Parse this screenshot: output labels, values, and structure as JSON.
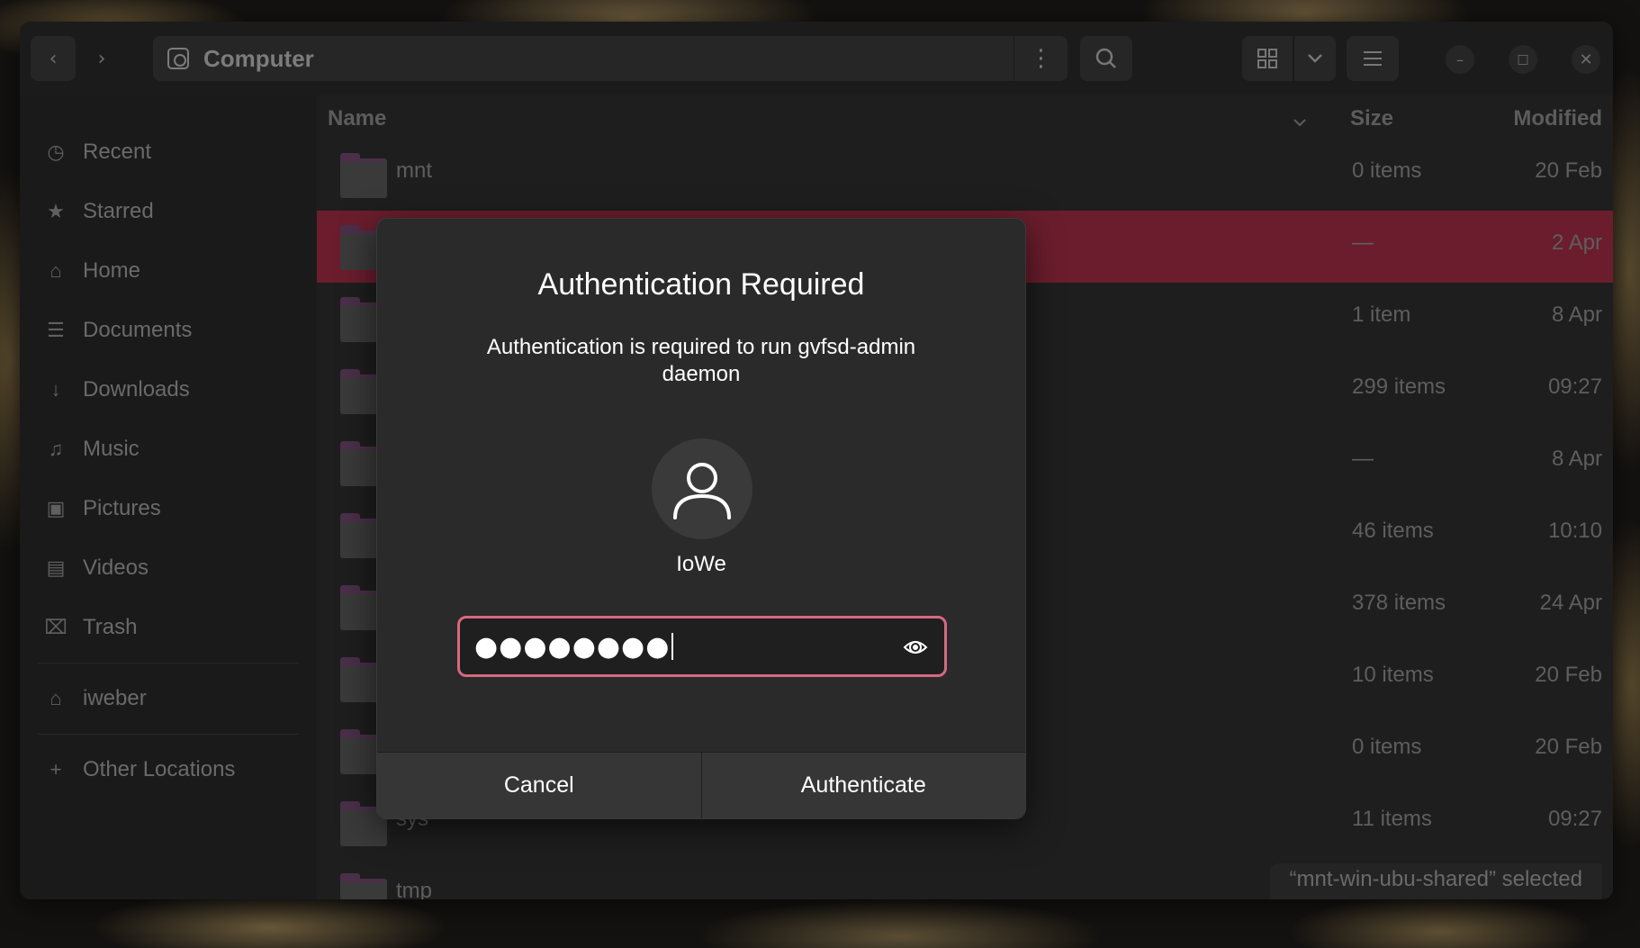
{
  "window": {
    "location": "Computer",
    "nav": {
      "back_icon": "chevron-left-icon",
      "forward_icon": "chevron-right-icon"
    },
    "header_icons": [
      "more-vertical-icon",
      "search-icon",
      "grid-view-icon",
      "chevron-down-icon",
      "hamburger-menu-icon",
      "minimize-icon",
      "maximize-icon",
      "close-icon"
    ]
  },
  "sidebar": {
    "items": [
      {
        "label": "Recent",
        "icon": "clock-icon"
      },
      {
        "label": "Starred",
        "icon": "star-icon"
      },
      {
        "label": "Home",
        "icon": "home-icon"
      },
      {
        "label": "Documents",
        "icon": "document-icon"
      },
      {
        "label": "Downloads",
        "icon": "download-icon"
      },
      {
        "label": "Music",
        "icon": "music-icon"
      },
      {
        "label": "Pictures",
        "icon": "picture-icon"
      },
      {
        "label": "Videos",
        "icon": "video-icon"
      },
      {
        "label": "Trash",
        "icon": "trash-icon"
      }
    ],
    "bookmarks": [
      {
        "label": "iweber",
        "icon": "home-icon"
      }
    ],
    "other": {
      "label": "Other Locations",
      "icon": "plus-icon"
    }
  },
  "list": {
    "columns": {
      "name": "Name",
      "size": "Size",
      "modified": "Modified"
    },
    "rows": [
      {
        "name": "mnt",
        "size": "0 items",
        "modified": "20 Feb",
        "selected": false
      },
      {
        "name": "",
        "size": "—",
        "modified": "2 Apr",
        "selected": true
      },
      {
        "name": "",
        "size": "1 item",
        "modified": "8 Apr",
        "selected": false
      },
      {
        "name": "",
        "size": "299 items",
        "modified": "09:27",
        "selected": false
      },
      {
        "name": "",
        "size": "—",
        "modified": "8 Apr",
        "selected": false
      },
      {
        "name": "",
        "size": "46 items",
        "modified": "10:10",
        "selected": false
      },
      {
        "name": "",
        "size": "378 items",
        "modified": "24 Apr",
        "selected": false
      },
      {
        "name": "",
        "size": "10 items",
        "modified": "20 Feb",
        "selected": false
      },
      {
        "name": "",
        "size": "0 items",
        "modified": "20 Feb",
        "selected": false
      },
      {
        "name": "sys",
        "size": "11 items",
        "modified": "09:27",
        "selected": false
      },
      {
        "name": "tmp",
        "size": "",
        "modified": "",
        "selected": false
      }
    ],
    "status": "“mnt-win-ubu-shared” selected"
  },
  "dialog": {
    "title": "Authentication Required",
    "message": "Authentication is required to run gvfsd-admin daemon",
    "user": "IoWe",
    "password_mask": "●●●●●●●●",
    "reveal_icon": "eye-icon",
    "cancel": "Cancel",
    "authenticate": "Authenticate"
  },
  "colors": {
    "selection": "#6b1d2d",
    "focus_ring": "#d5697f"
  }
}
